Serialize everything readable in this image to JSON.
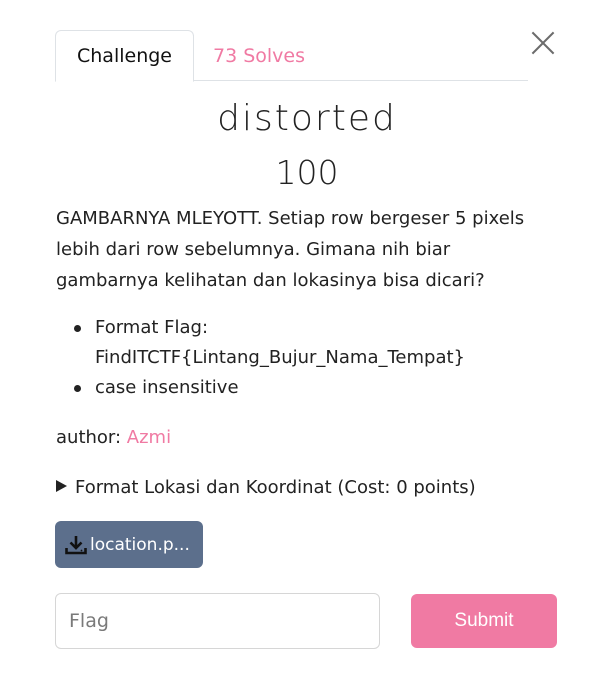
{
  "tabs": {
    "challenge": "Challenge",
    "solves": "73 Solves"
  },
  "challenge": {
    "name": "distorted",
    "points": "100",
    "description": "GAMBARNYA MLEYOTT. Setiap row bergeser 5 pixels lebih dari row sebelumnya. Gimana nih biar gambarnya kelihatan dan lokasinya bisa dicari?",
    "bullets": [
      "Format Flag: FindITCTF{Lintang_Bujur_Nama_Tempat}",
      "case insensitive"
    ],
    "author_label": "author: ",
    "author_name": "Azmi",
    "hint": "Format Lokasi dan Koordinat (Cost: 0 points)",
    "file_label": "location.p..."
  },
  "form": {
    "flag_placeholder": "Flag",
    "flag_value": "",
    "submit_label": "Submit"
  },
  "colors": {
    "accent": "#f07aa3",
    "file_button": "#5c6f8c"
  },
  "icons": {
    "close": "close-icon",
    "download": "download-icon",
    "disclosure": "triangle-right-icon"
  }
}
